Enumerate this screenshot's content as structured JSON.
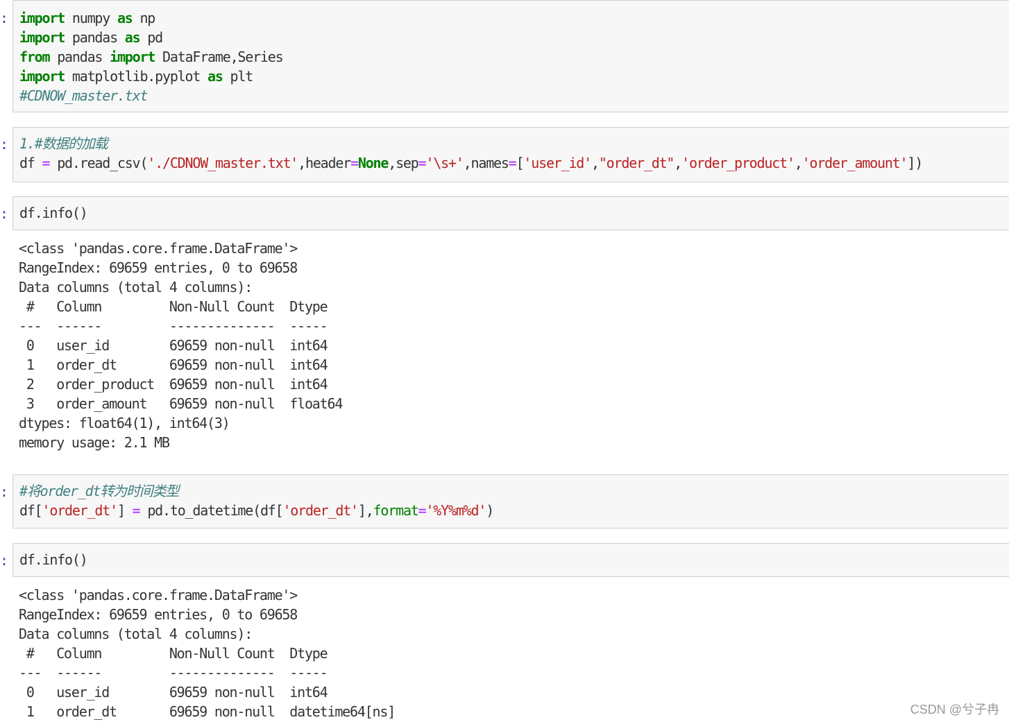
{
  "prompt_char": ":",
  "cell1": {
    "l1_kw1": "import",
    "l1_mid": " numpy ",
    "l1_kw2": "as",
    "l1_end": " np",
    "l2_kw1": "import",
    "l2_mid": " pandas ",
    "l2_kw2": "as",
    "l2_end": " pd",
    "l3_kw1": "from",
    "l3_mid": " pandas ",
    "l3_kw2": "import",
    "l3_end": " DataFrame,Series",
    "l4_kw1": "import",
    "l4_mid": " matplotlib.pyplot ",
    "l4_kw2": "as",
    "l4_end": " plt",
    "l5_comment": "#CDNOW_master.txt"
  },
  "cell2": {
    "l1_num": "1.",
    "l1_comment": "#数据的加载",
    "l2_a": "df ",
    "l2_eq": "=",
    "l2_b": " pd.read_csv(",
    "l2_path": "'./CDNOW_master.txt'",
    "l2_c": ",header",
    "l2_eq2": "=",
    "l2_none": "None",
    "l2_d": ",sep",
    "l2_eq3": "=",
    "l2_sep": "'\\s+'",
    "l2_e": ",names",
    "l2_eq4": "=",
    "l2_f": "[",
    "l2_n1": "'user_id'",
    "l2_comma1": ",",
    "l2_n2": "\"order_dt\"",
    "l2_comma2": ",",
    "l2_n3": "'order_product'",
    "l2_comma3": ",",
    "l2_n4": "'order_amount'",
    "l2_g": "])"
  },
  "cell3": {
    "code": "df.info()",
    "output": [
      "<class 'pandas.core.frame.DataFrame'>",
      "RangeIndex: 69659 entries, 0 to 69658",
      "Data columns (total 4 columns):",
      " #   Column         Non-Null Count  Dtype  ",
      "---  ------         --------------  -----  ",
      " 0   user_id        69659 non-null  int64  ",
      " 1   order_dt       69659 non-null  int64  ",
      " 2   order_product  69659 non-null  int64  ",
      " 3   order_amount   69659 non-null  float64",
      "dtypes: float64(1), int64(3)",
      "memory usage: 2.1 MB"
    ]
  },
  "cell4": {
    "l1_comment": "#将order_dt转为时间类型",
    "l2_a": "df[",
    "l2_s1": "'order_dt'",
    "l2_b": "] ",
    "l2_eq": "=",
    "l2_c": " pd.to_datetime(df[",
    "l2_s2": "'order_dt'",
    "l2_d": "],",
    "l2_kw": "format",
    "l2_eq2": "=",
    "l2_s3": "'%Y%m%d'",
    "l2_e": ")"
  },
  "cell5": {
    "code": "df.info()",
    "output": [
      "<class 'pandas.core.frame.DataFrame'>",
      "RangeIndex: 69659 entries, 0 to 69658",
      "Data columns (total 4 columns):",
      " #   Column         Non-Null Count  Dtype         ",
      "---  ------         --------------  -----         ",
      " 0   user_id        69659 non-null  int64         ",
      " 1   order_dt       69659 non-null  datetime64[ns]"
    ]
  },
  "watermark": "CSDN @兮子冉"
}
